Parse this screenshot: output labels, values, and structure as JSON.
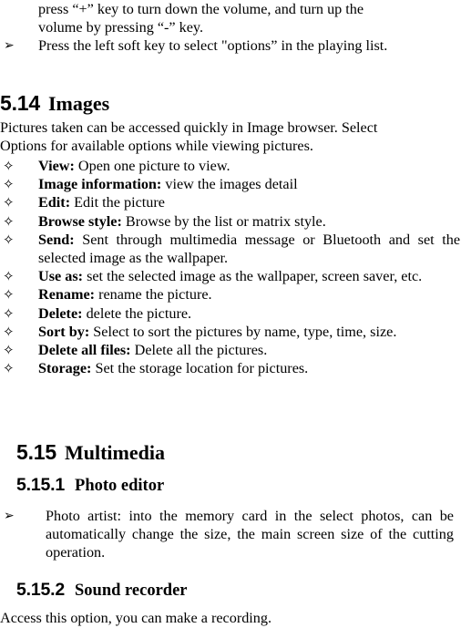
{
  "document": {
    "continuation_paragraph": {
      "line1": "press “+” key to turn down the volume, and turn up the",
      "line2": "volume by pressing “-” key."
    },
    "arrow_bullet_glyph": "➢",
    "diamond_bullet_glyph": "✧",
    "top_arrow_item": "Press the left soft key to select \"options” in the playing list.",
    "section_images": {
      "number": "5.14",
      "title": "Images",
      "intro_line1": "Pictures taken can be accessed quickly in Image browser. Select",
      "intro_line2": "Options for available options while viewing pictures.",
      "options": [
        {
          "lead": "View:",
          "desc": "Open one picture to view."
        },
        {
          "lead": "Image information:",
          "desc": "view the images detail"
        },
        {
          "lead": "Edit:",
          "desc": "Edit the picture"
        },
        {
          "lead": "Browse style:",
          "desc": "Browse by the list or matrix style."
        },
        {
          "lead": "Send:",
          "desc": "Sent through multimedia message or Bluetooth and set the selected image as the wallpaper."
        },
        {
          "lead": "Use as:",
          "desc": "set the selected image as the wallpaper, screen saver, etc."
        },
        {
          "lead": "Rename:",
          "desc": "rename the picture."
        },
        {
          "lead": "Delete:",
          "desc": "delete the picture."
        },
        {
          "lead": "Sort by:",
          "desc": "Select to sort the pictures by name, type, time, size."
        },
        {
          "lead": "Delete all files:",
          "desc": "Delete all the pictures."
        },
        {
          "lead": "Storage:",
          "desc": "Set the storage location for pictures."
        }
      ]
    },
    "section_multimedia": {
      "number": "5.15",
      "title": "Multimedia",
      "sub_photo_editor": {
        "number": "5.15.1",
        "title": "Photo editor",
        "item": "Photo artist: into the memory card in the select photos, can be automatically change the size, the main screen size of the cutting operation."
      },
      "sub_sound_recorder": {
        "number": "5.15.2",
        "title": "Sound recorder",
        "body": "Access this option, you can make a recording."
      }
    }
  }
}
